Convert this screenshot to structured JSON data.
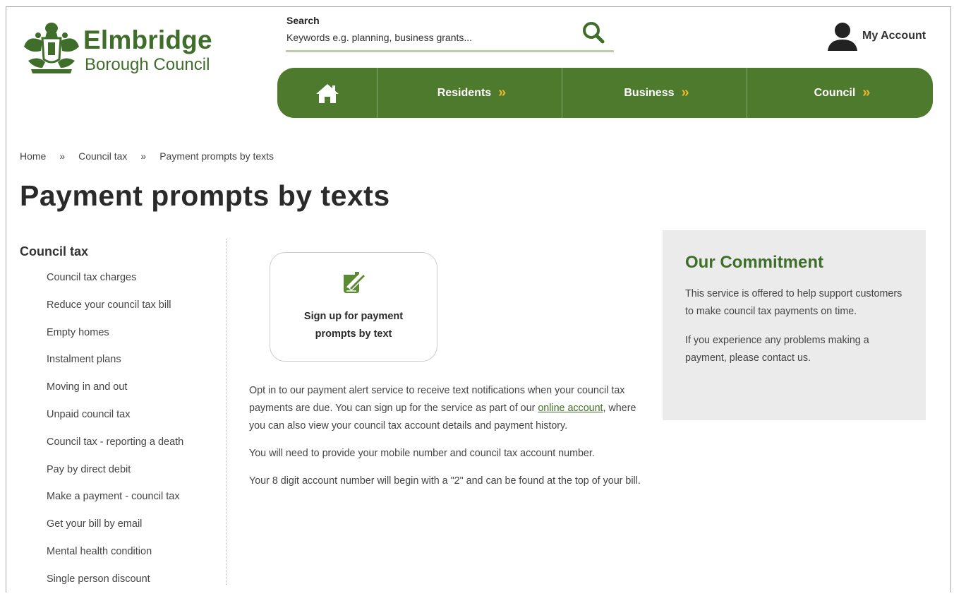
{
  "header": {
    "logo": {
      "name": "Elmbridge",
      "sub": "Borough Council",
      "crest_icon": "council-crest-icon"
    },
    "search": {
      "label": "Search",
      "placeholder": "Keywords e.g. planning, business grants...",
      "value": "",
      "icon": "search-icon"
    },
    "account": {
      "label": "My Account",
      "icon": "user-icon"
    }
  },
  "nav": {
    "home_icon": "home-icon",
    "items": [
      {
        "label": "Residents"
      },
      {
        "label": "Business"
      },
      {
        "label": "Council"
      }
    ],
    "chevron": "»"
  },
  "breadcrumb": {
    "items": [
      "Home",
      "Council tax",
      "Payment prompts by texts"
    ],
    "separator": "»"
  },
  "page_title": "Payment prompts by texts",
  "sidebar": {
    "title": "Council tax",
    "items": [
      "Council tax charges",
      "Reduce your council tax bill",
      "Empty homes",
      "Instalment plans",
      "Moving in and out",
      "Unpaid council tax",
      "Council tax - reporting a death",
      "Pay by direct debit",
      "Make a payment - council tax",
      "Get your bill by email",
      "Mental health condition",
      "Single person discount"
    ]
  },
  "card": {
    "icon": "edit-document-icon",
    "label": "Sign up for payment prompts by text"
  },
  "content": {
    "p1_before": "Opt in to our payment alert service to receive text notifications when your council tax payments are due. You can sign up for the service as part of our ",
    "p1_link": "online account",
    "p1_after": ", where you can also view your council tax account details and payment history.",
    "p2": "You will need to provide your mobile number and council tax account number.",
    "p3": "Your 8 digit account number will begin with a \"2\" and can be found at the top of your bill."
  },
  "commitment": {
    "title": "Our Commitment",
    "p1": "This service is offered to help support customers to make council tax payments on time.",
    "p2": "If you experience any problems making a payment, please contact us."
  },
  "colors": {
    "brand_green": "#4e7a2e",
    "chevron_gold": "#e8b92a",
    "panel_grey": "#ebebeb"
  }
}
